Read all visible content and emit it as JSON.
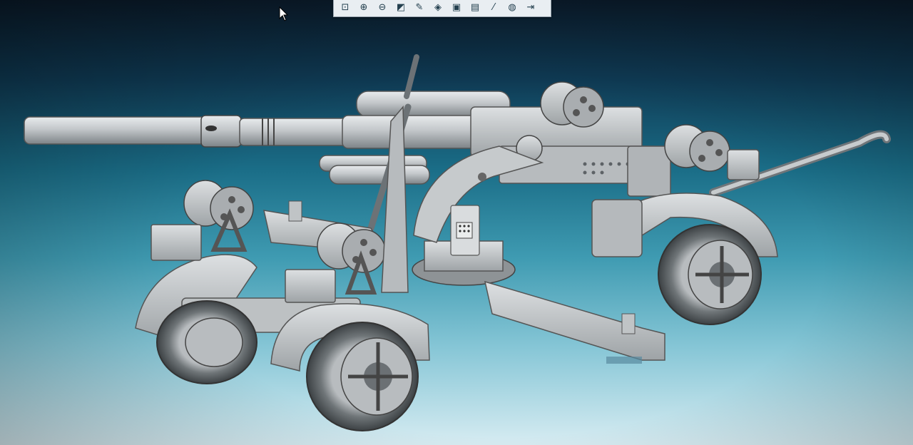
{
  "viewport": {
    "background_top": "#0b1c2c",
    "background_bottom": "#d7ecf2",
    "model_color": "#c9cdcf"
  },
  "toolbar": {
    "buttons": [
      {
        "icon": "zoom-fit-icon",
        "glyph": "⊡"
      },
      {
        "icon": "zoom-in-icon",
        "glyph": "⊕"
      },
      {
        "icon": "zoom-out-icon",
        "glyph": "⊖"
      },
      {
        "icon": "view-orientation-icon",
        "glyph": "◩"
      },
      {
        "icon": "section-view-icon",
        "glyph": "✎"
      },
      {
        "icon": "isometric-view-icon",
        "glyph": "◈"
      },
      {
        "icon": "display-style-icon",
        "glyph": "▣"
      },
      {
        "icon": "save-view-icon",
        "glyph": "▤"
      },
      {
        "icon": "hide-show-icon",
        "glyph": "⁄"
      },
      {
        "icon": "appearance-icon",
        "glyph": "◍"
      },
      {
        "icon": "scene-icon",
        "glyph": "⇥"
      }
    ]
  }
}
